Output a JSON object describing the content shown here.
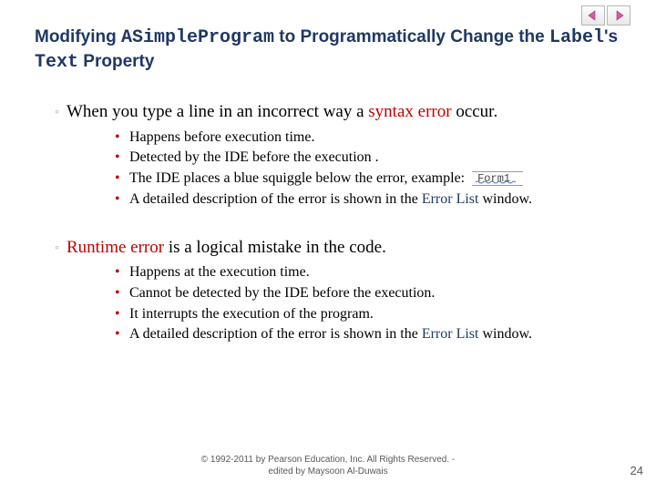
{
  "nav": {
    "prev_icon": "prev-arrow-icon",
    "next_icon": "next-arrow-icon"
  },
  "title": {
    "pre1": "Modifying ",
    "code1": "ASimpleProgram",
    "mid1": " to Programmatically Change the ",
    "code2": "Label",
    "mid2": "'s ",
    "code3": "Text",
    "post": " Property"
  },
  "section1": {
    "lead_pre": "When you type a line in an incorrect way a ",
    "lead_red": "syntax error",
    "lead_post": " occur.",
    "items": [
      {
        "text": "Happens before execution time."
      },
      {
        "text": "Detected by the IDE before the execution ."
      },
      {
        "pre": "The IDE places a blue squiggle below the error, example: ",
        "squiggle_label": "Form1"
      },
      {
        "pre": "A detailed description of the error is shown in the ",
        "blue": "Error List",
        "post": " window."
      }
    ]
  },
  "section2": {
    "lead_red": "Runtime error",
    "lead_post": "  is a logical mistake in the code.",
    "items": [
      {
        "text": "Happens at the execution time."
      },
      {
        "text": "Cannot be detected by the IDE before the execution."
      },
      {
        "text": "It interrupts the execution of the program."
      },
      {
        "pre": "A detailed description of the error is shown in the ",
        "blue": "Error List",
        "post": " window."
      }
    ]
  },
  "footer": {
    "line1": "© 1992-2011 by Pearson Education, Inc. All Rights Reserved. -",
    "line2": "edited by Maysoon Al-Duwais"
  },
  "page_number": "24"
}
